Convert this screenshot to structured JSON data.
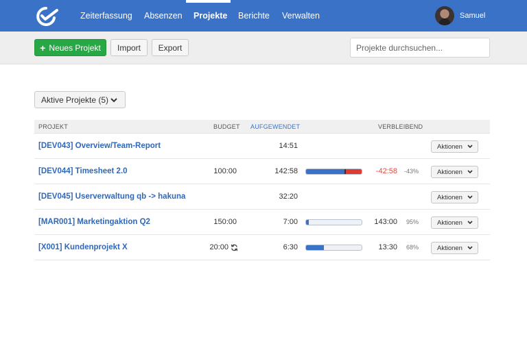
{
  "nav": {
    "items": [
      {
        "label": "Zeiterfassung",
        "active": false
      },
      {
        "label": "Absenzen",
        "active": false
      },
      {
        "label": "Projekte",
        "active": true
      },
      {
        "label": "Berichte",
        "active": false
      },
      {
        "label": "Verwalten",
        "active": false
      }
    ],
    "user_name": "Samuel",
    "logo_icon": "checkmark-clock-icon",
    "accent_color": "#3a72c7"
  },
  "toolbar": {
    "new_project_label": "Neues Projekt",
    "import_label": "Import",
    "export_label": "Export",
    "search_placeholder": "Projekte durchsuchen..."
  },
  "filter": {
    "label": "Aktive Projekte (5)"
  },
  "table": {
    "columns": {
      "project": "PROJEKT",
      "budget": "BUDGET",
      "spent": "AUFGEWENDET",
      "remaining": "VERBLEIBEND"
    },
    "action_label": "Aktionen",
    "rows": [
      {
        "name": "[DEV043] Overview/Team-Report",
        "budget": "",
        "spent": "14:51",
        "remaining": "",
        "percent": "",
        "progress": null,
        "over_budget": false,
        "recurring": false
      },
      {
        "name": "[DEV044] Timesheet 2.0",
        "budget": "100:00",
        "spent": "142:58",
        "remaining": "-42:58",
        "percent": "-43%",
        "progress": 1.43,
        "over_budget": true,
        "recurring": false
      },
      {
        "name": "[DEV045] Userverwaltung qb -> hakuna",
        "budget": "",
        "spent": "32:20",
        "remaining": "",
        "percent": "",
        "progress": null,
        "over_budget": false,
        "recurring": false
      },
      {
        "name": "[MAR001] Marketingaktion Q2",
        "budget": "150:00",
        "spent": "7:00",
        "remaining": "143:00",
        "percent": "95%",
        "progress": 0.05,
        "over_budget": false,
        "recurring": false
      },
      {
        "name": "[X001] Kundenprojekt X",
        "budget": "20:00",
        "spent": "6:30",
        "remaining": "13:30",
        "percent": "68%",
        "progress": 0.32,
        "over_budget": false,
        "recurring": true
      }
    ]
  }
}
